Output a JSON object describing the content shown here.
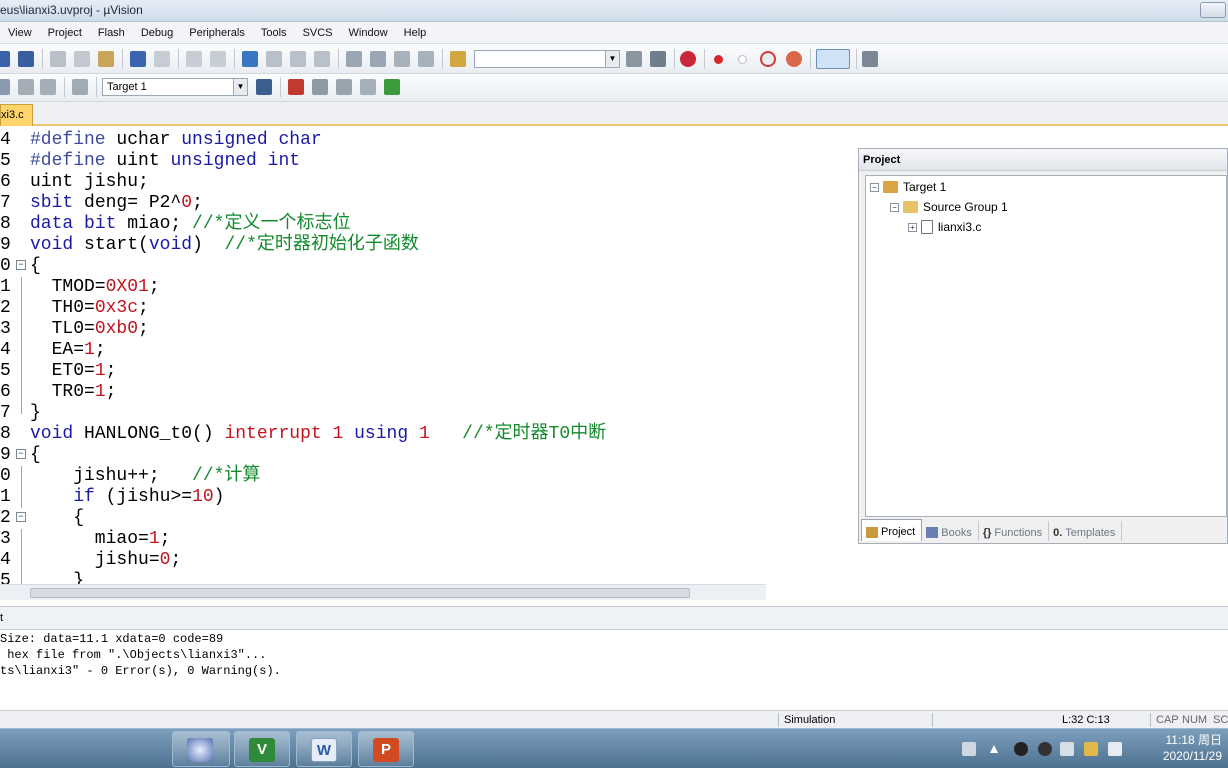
{
  "window": {
    "title": "eus\\lianxi3.uvproj - µVision"
  },
  "menu": [
    "View",
    "Project",
    "Flash",
    "Debug",
    "Peripherals",
    "Tools",
    "SVCS",
    "Window",
    "Help"
  ],
  "toolbar": {
    "target_combo": "Target 1",
    "find_combo": ""
  },
  "file_tab": {
    "label": "xi3.c"
  },
  "editor": {
    "lines": [
      {
        "n": "4",
        "segs": [
          {
            "t": "#define",
            "c": "pp"
          },
          {
            "t": " uchar ",
            "c": ""
          },
          {
            "t": "unsigned char",
            "c": "kw"
          }
        ]
      },
      {
        "n": "5",
        "segs": [
          {
            "t": "#define",
            "c": "pp"
          },
          {
            "t": " uint ",
            "c": ""
          },
          {
            "t": "unsigned int",
            "c": "kw"
          }
        ]
      },
      {
        "n": "6",
        "segs": [
          {
            "t": "uint jishu;",
            "c": ""
          }
        ]
      },
      {
        "n": "7",
        "segs": [
          {
            "t": "sbit",
            "c": "kw"
          },
          {
            "t": " deng= P2^",
            "c": ""
          },
          {
            "t": "0",
            "c": "num"
          },
          {
            "t": ";",
            "c": ""
          }
        ]
      },
      {
        "n": "8",
        "segs": [
          {
            "t": "data bit",
            "c": "kw"
          },
          {
            "t": " miao; ",
            "c": ""
          },
          {
            "t": "//*定义一个标志位",
            "c": "cm"
          }
        ]
      },
      {
        "n": "9",
        "segs": [
          {
            "t": "void",
            "c": "kw"
          },
          {
            "t": " start(",
            "c": ""
          },
          {
            "t": "void",
            "c": "kw"
          },
          {
            "t": ")  ",
            "c": ""
          },
          {
            "t": "//*定时器初始化子函数",
            "c": "cm"
          }
        ]
      },
      {
        "n": "0",
        "fold": "minus",
        "segs": [
          {
            "t": "{",
            "c": ""
          }
        ]
      },
      {
        "n": "1",
        "fold": "line",
        "segs": [
          {
            "t": "  TMOD=",
            "c": ""
          },
          {
            "t": "0X01",
            "c": "num"
          },
          {
            "t": ";",
            "c": ""
          }
        ]
      },
      {
        "n": "2",
        "fold": "line",
        "segs": [
          {
            "t": "  TH0=",
            "c": ""
          },
          {
            "t": "0x3c",
            "c": "num"
          },
          {
            "t": ";",
            "c": ""
          }
        ]
      },
      {
        "n": "3",
        "fold": "line",
        "segs": [
          {
            "t": "  TL0=",
            "c": ""
          },
          {
            "t": "0xb0",
            "c": "num"
          },
          {
            "t": ";",
            "c": ""
          }
        ]
      },
      {
        "n": "4",
        "fold": "line",
        "segs": [
          {
            "t": "  EA=",
            "c": ""
          },
          {
            "t": "1",
            "c": "num"
          },
          {
            "t": ";",
            "c": ""
          }
        ]
      },
      {
        "n": "5",
        "fold": "line",
        "segs": [
          {
            "t": "  ET0=",
            "c": ""
          },
          {
            "t": "1",
            "c": "num"
          },
          {
            "t": ";",
            "c": ""
          }
        ]
      },
      {
        "n": "6",
        "fold": "line",
        "segs": [
          {
            "t": "  TR0=",
            "c": ""
          },
          {
            "t": "1",
            "c": "num"
          },
          {
            "t": ";",
            "c": ""
          }
        ]
      },
      {
        "n": "7",
        "fold": "end",
        "segs": [
          {
            "t": "}",
            "c": ""
          }
        ]
      },
      {
        "n": "8",
        "segs": [
          {
            "t": "void",
            "c": "kw"
          },
          {
            "t": " HANLONG_t0() ",
            "c": ""
          },
          {
            "t": "interrupt",
            "c": "num"
          },
          {
            "t": " ",
            "c": ""
          },
          {
            "t": "1",
            "c": "num"
          },
          {
            "t": " ",
            "c": ""
          },
          {
            "t": "using",
            "c": "kw"
          },
          {
            "t": " ",
            "c": ""
          },
          {
            "t": "1",
            "c": "num"
          },
          {
            "t": "   ",
            "c": ""
          },
          {
            "t": "//*定时器T0中断",
            "c": "cm"
          }
        ]
      },
      {
        "n": "9",
        "fold": "minus",
        "segs": [
          {
            "t": "{",
            "c": ""
          }
        ]
      },
      {
        "n": "0",
        "fold": "line",
        "segs": [
          {
            "t": "    jishu++;   ",
            "c": ""
          },
          {
            "t": "//*计算",
            "c": "cm"
          }
        ]
      },
      {
        "n": "1",
        "fold": "line",
        "segs": [
          {
            "t": "    ",
            "c": ""
          },
          {
            "t": "if",
            "c": "kw"
          },
          {
            "t": " (jishu>=",
            "c": ""
          },
          {
            "t": "10",
            "c": "num"
          },
          {
            "t": ")",
            "c": ""
          }
        ]
      },
      {
        "n": "2",
        "fold": "minus",
        "segs": [
          {
            "t": "    {",
            "c": ""
          }
        ]
      },
      {
        "n": "3",
        "fold": "line",
        "segs": [
          {
            "t": "      miao=",
            "c": ""
          },
          {
            "t": "1",
            "c": "num"
          },
          {
            "t": ";",
            "c": ""
          }
        ]
      },
      {
        "n": "4",
        "fold": "line",
        "segs": [
          {
            "t": "      jishu=",
            "c": ""
          },
          {
            "t": "0",
            "c": "num"
          },
          {
            "t": ";",
            "c": ""
          }
        ]
      },
      {
        "n": "5",
        "fold": "line",
        "segs": [
          {
            "t": "    }",
            "c": ""
          }
        ]
      }
    ]
  },
  "project_pane": {
    "title": "Project",
    "tree": [
      "Target 1",
      "Source Group 1",
      "lianxi3.c"
    ],
    "tabs": [
      "Project",
      "Books",
      "Functions",
      "Templates"
    ]
  },
  "output": {
    "header": "t",
    "lines": [
      "Size: data=11.1 xdata=0 code=89",
      " hex file from \".\\Objects\\lianxi3\"...",
      "ts\\lianxi3\" - 0 Error(s), 0 Warning(s)."
    ]
  },
  "statusbar": {
    "mode": "Simulation",
    "position": "L:32 C:13",
    "caps": "CAP",
    "num": "NUM",
    "scrl": "SC"
  },
  "taskbar": {
    "time": "11:18 周日",
    "date": "2020/11/29"
  },
  "colors": {
    "keyword": "#1a1aa6",
    "number": "#c0141e",
    "comment": "#138a2c",
    "tab_active": "#ffd56b"
  }
}
